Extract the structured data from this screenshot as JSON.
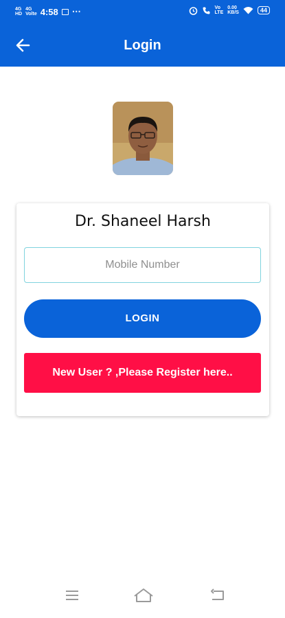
{
  "status_bar": {
    "network_left": "4G",
    "network_sub": "HD",
    "volte": "4G",
    "volte_sub": "Volte",
    "time": "4:58",
    "more": "⋯",
    "speed": "0.00",
    "speed_unit": "KB/S",
    "battery": "44"
  },
  "header": {
    "title": "Login"
  },
  "profile": {
    "name": "Dr. Shaneel Harsh"
  },
  "form": {
    "mobile_placeholder": "Mobile Number",
    "login_label": "LOGIN",
    "register_label": "New User ? ,Please Register here.."
  },
  "colors": {
    "primary": "#0a63d9",
    "register": "#ff0f46",
    "input_border": "#7fd3de"
  },
  "icons": [
    "back-arrow-icon",
    "menu-icon",
    "home-icon",
    "back-nav-icon",
    "alarm-icon",
    "wifi-icon"
  ]
}
